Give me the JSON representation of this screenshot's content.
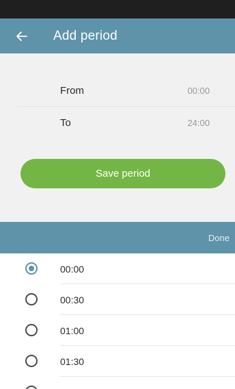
{
  "app_bar": {
    "title": "Add period",
    "back_icon": "arrow-left-icon"
  },
  "form": {
    "from_label": "From",
    "from_value": "00:00",
    "to_label": "To",
    "to_value": "24:00",
    "save_label": "Save period"
  },
  "picker": {
    "done_label": "Done",
    "selected": "00:00",
    "options": [
      {
        "label": "00:00",
        "checked": true
      },
      {
        "label": "00:30",
        "checked": false
      },
      {
        "label": "01:00",
        "checked": false
      },
      {
        "label": "01:30",
        "checked": false
      }
    ]
  },
  "colors": {
    "header": "#5e93a9",
    "accent_green": "#74b645",
    "status_bar": "#1f1f1f",
    "panel": "#f1f1f1"
  }
}
